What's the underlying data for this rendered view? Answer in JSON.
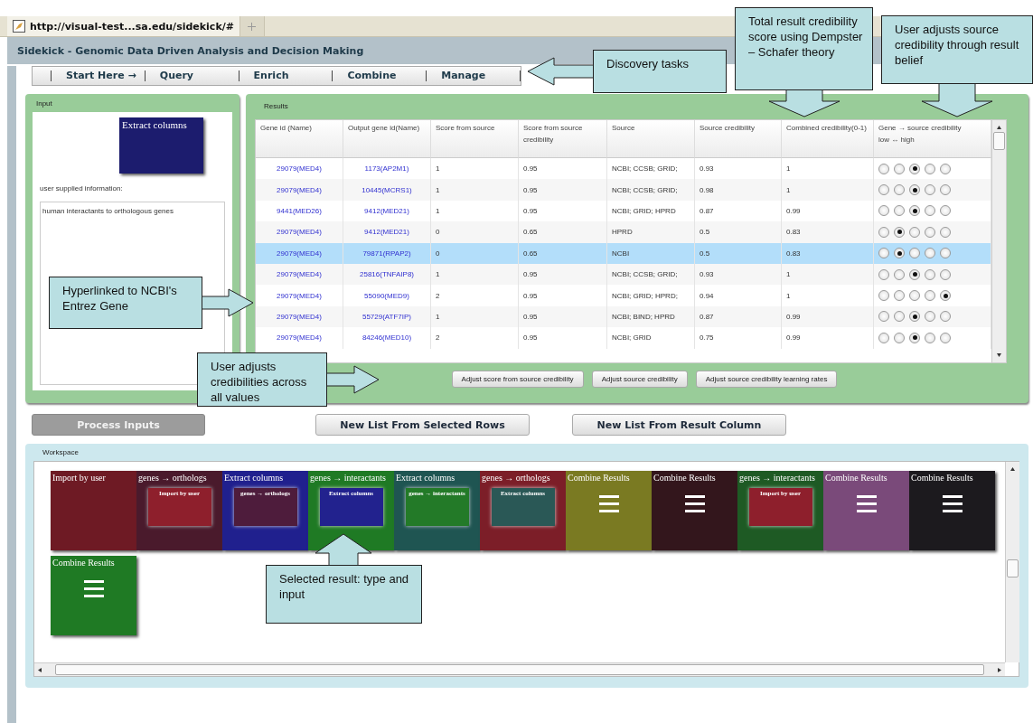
{
  "browser_tab": {
    "title": "http://visual-test...sa.edu/sidekick/#"
  },
  "app": {
    "title": "Sidekick - Genomic Data Driven Analysis and Decision Making"
  },
  "menu": [
    {
      "label": "Start Here →"
    },
    {
      "label": "Query"
    },
    {
      "label": "Enrich"
    },
    {
      "label": "Combine"
    },
    {
      "label": "Manage"
    }
  ],
  "input_panel": {
    "title": "Input",
    "node_label": "Extract columns",
    "info_label": "user supplied information:",
    "info_text": "human interactants to orthologous genes"
  },
  "results_panel": {
    "title": "Results",
    "columns": [
      {
        "label": "Gene id (Name)"
      },
      {
        "label": "Output gene id(Name)"
      },
      {
        "label": "Score from source"
      },
      {
        "label": "Score from source credibility"
      },
      {
        "label": "Source"
      },
      {
        "label": "Source credibility"
      },
      {
        "label": "Combined credibility(0-1)"
      },
      {
        "label": "Gene → source credibility",
        "sublabel": "low ↔ high"
      }
    ],
    "rows": [
      {
        "selected": false,
        "cells": [
          "29079(MED4)",
          "1173(AP2M1)",
          "1",
          "0.95",
          "NCBI; CCSB; GRID;",
          "0.93",
          "1"
        ],
        "belief": [
          {
            "selected": false
          },
          {
            "selected": false
          },
          {
            "selected": true
          },
          {
            "selected": false
          },
          {
            "selected": false
          }
        ]
      },
      {
        "selected": false,
        "cells": [
          "29079(MED4)",
          "10445(MCRS1)",
          "1",
          "0.95",
          "NCBI; CCSB; GRID;",
          "0.98",
          "1"
        ],
        "belief": [
          {
            "selected": false
          },
          {
            "selected": false
          },
          {
            "selected": true
          },
          {
            "selected": false
          },
          {
            "selected": false
          }
        ]
      },
      {
        "selected": false,
        "cells": [
          "9441(MED26)",
          "9412(MED21)",
          "1",
          "0.95",
          "NCBI; GRID; HPRD",
          "0.87",
          "0.99"
        ],
        "belief": [
          {
            "selected": false
          },
          {
            "selected": false
          },
          {
            "selected": true
          },
          {
            "selected": false
          },
          {
            "selected": false
          }
        ]
      },
      {
        "selected": false,
        "cells": [
          "29079(MED4)",
          "9412(MED21)",
          "0",
          "0.65",
          "HPRD",
          "0.5",
          "0.83"
        ],
        "belief": [
          {
            "selected": false
          },
          {
            "selected": true
          },
          {
            "selected": false
          },
          {
            "selected": false
          },
          {
            "selected": false
          }
        ]
      },
      {
        "selected": true,
        "cells": [
          "29079(MED4)",
          "79871(RPAP2)",
          "0",
          "0.65",
          "NCBI",
          "0.5",
          "0.83"
        ],
        "belief": [
          {
            "selected": false
          },
          {
            "selected": true
          },
          {
            "selected": false
          },
          {
            "selected": false
          },
          {
            "selected": false
          }
        ]
      },
      {
        "selected": false,
        "cells": [
          "29079(MED4)",
          "25816(TNFAIP8)",
          "1",
          "0.95",
          "NCBI; CCSB; GRID;",
          "0.93",
          "1"
        ],
        "belief": [
          {
            "selected": false
          },
          {
            "selected": false
          },
          {
            "selected": true
          },
          {
            "selected": false
          },
          {
            "selected": false
          }
        ]
      },
      {
        "selected": false,
        "cells": [
          "29079(MED4)",
          "55090(MED9)",
          "2",
          "0.95",
          "NCBI; GRID; HPRD;",
          "0.94",
          "1"
        ],
        "belief": [
          {
            "selected": false
          },
          {
            "selected": false
          },
          {
            "selected": false
          },
          {
            "selected": false
          },
          {
            "selected": true
          }
        ]
      },
      {
        "selected": false,
        "cells": [
          "29079(MED4)",
          "55729(ATF7IP)",
          "1",
          "0.95",
          "NCBI; BIND; HPRD",
          "0.87",
          "0.99"
        ],
        "belief": [
          {
            "selected": false
          },
          {
            "selected": false
          },
          {
            "selected": true
          },
          {
            "selected": false
          },
          {
            "selected": false
          }
        ]
      },
      {
        "selected": false,
        "cells": [
          "29079(MED4)",
          "84246(MED10)",
          "2",
          "0.95",
          "NCBI; GRID",
          "0.75",
          "0.99"
        ],
        "belief": [
          {
            "selected": false
          },
          {
            "selected": false
          },
          {
            "selected": true
          },
          {
            "selected": false
          },
          {
            "selected": false
          }
        ]
      }
    ],
    "buttons": [
      "Adjust score from source credibility",
      "Adjust source credibility",
      "Adjust source credibility learning rates"
    ]
  },
  "actions": [
    {
      "label": "Process Inputs",
      "disabled": true
    },
    {
      "label": "New List From Selected Rows",
      "disabled": false
    },
    {
      "label": "New List From Result Column",
      "disabled": false
    }
  ],
  "workspace": {
    "title": "Workspace",
    "nodes": [
      {
        "kind": "import",
        "title": "Import by user",
        "color": "#6e1a24"
      },
      {
        "kind": "transform",
        "title": "genes → orthologs",
        "color": "#4a1a2c",
        "input": {
          "label": "Import by user",
          "color": "#8e1f2c"
        }
      },
      {
        "kind": "transform",
        "title": "Extract columns",
        "color": "#20208e",
        "input": {
          "label": "genes → orthologs",
          "color": "#4e1c3c"
        }
      },
      {
        "kind": "transform",
        "title": "genes → interactants",
        "color": "#1f7a24",
        "input": {
          "label": "Extract columns",
          "color": "#22228e"
        }
      },
      {
        "kind": "transform",
        "title": "Extract columns",
        "color": "#1f5552",
        "input": {
          "label": "genes → interactants",
          "color": "#237a28"
        }
      },
      {
        "kind": "transform",
        "title": "genes → orthologs",
        "color": "#7c1e28",
        "input": {
          "label": "Extract columns",
          "color": "#2a5856"
        }
      },
      {
        "kind": "combine",
        "title": "Combine Results",
        "color": "#7a7a22"
      },
      {
        "kind": "combine",
        "title": "Combine Results",
        "color": "#33161c"
      },
      {
        "kind": "transform",
        "title": "genes → interactants",
        "color": "#1e5a24",
        "input": {
          "label": "Import by user",
          "color": "#8e1f2c"
        }
      },
      {
        "kind": "combine",
        "title": "Combine Results",
        "color": "#7a4a7a"
      },
      {
        "kind": "combine",
        "title": "Combine Results",
        "color": "#1c1a1e"
      },
      {
        "kind": "combine",
        "title": "Combine Results",
        "color": "#1f7a24"
      }
    ]
  },
  "callouts": [
    {
      "text": "Discovery tasks",
      "kind": "left"
    },
    {
      "text": "Total result credibility score using Dempster – Schafer theory",
      "kind": "down"
    },
    {
      "text": "User adjusts source credibility through result belief",
      "kind": "down"
    },
    {
      "text": "Hyperlinked to NCBI's Entrez Gene",
      "kind": "right"
    },
    {
      "text": "User adjusts credibilities across all values",
      "kind": "right"
    },
    {
      "text": "Selected result: type and input",
      "kind": "up"
    }
  ]
}
